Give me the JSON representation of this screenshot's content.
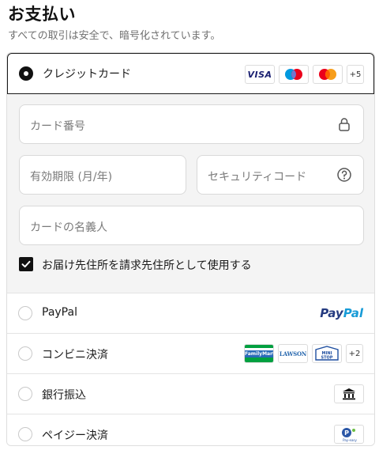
{
  "header": {
    "title": "お支払い",
    "subtitle": "すべての取引は安全で、暗号化されています。"
  },
  "card": {
    "label": "クレジットカード",
    "selected": true,
    "brands": [
      "VISA",
      "Maestro",
      "Mastercard"
    ],
    "visa_label": "VISA",
    "more_label": "+5",
    "fields": {
      "number_placeholder": "カード番号",
      "expiry_placeholder": "有効期限 (月/年)",
      "cvc_placeholder": "セキュリティコード",
      "name_placeholder": "カードの名義人"
    },
    "same_address_label": "お届け先住所を請求先住所として使用する",
    "same_address_checked": true
  },
  "methods": [
    {
      "label": "PayPal",
      "logo_a": "Pay",
      "logo_b": "Pal"
    },
    {
      "label": "コンビニ決済",
      "logos": [
        "FamilyMart",
        "LAWSON",
        "MINISTOP"
      ],
      "more_label": "+2",
      "famima_label": "FamilyMart",
      "lawson_label": "LAWSON",
      "ministop_label": "MINI STOP"
    },
    {
      "label": "銀行振込",
      "icon": "bank-icon"
    },
    {
      "label": "ペイジー決済",
      "icon": "pay-easy-icon",
      "logo_text": "Pay-easy"
    }
  ],
  "colors": {
    "primary": "#111111",
    "border": "#dedede",
    "form_bg": "#f4f4f4",
    "visa": "#1a1f71",
    "maestro_red": "#eb001b",
    "maestro_blue": "#0099df",
    "mastercard_orange": "#f79e1b",
    "paypal_dark": "#253b80",
    "paypal_light": "#179bd7",
    "familymart_green": "#00a040",
    "lawson_blue": "#2566ad"
  }
}
